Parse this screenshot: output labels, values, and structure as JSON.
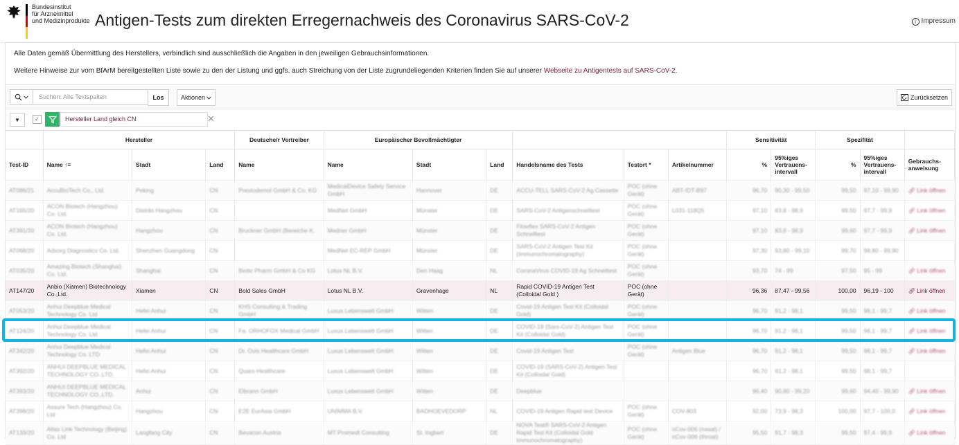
{
  "header": {
    "logo_text": "Bundesinstitut\nfür Arzneimittel\nund Medizinprodukte",
    "title": "Antigen-Tests zum direkten Erregernachweis des Coronavirus SARS-CoV-2",
    "impressum": "Impressum"
  },
  "info": {
    "line1": "Alle Daten gemäß Übermittlung des Herstellers, verbindlich sind ausschließlich die Angaben in den jeweiligen Gebrauchsinformationen.",
    "line2_prefix": "Weitere Hinweise zur vom BfArM bereitgestellten Liste sowie zu den der Listung und ggfs. auch Streichung von der Liste zugrundeliegenden Kriterien finden Sie auf unserer ",
    "line2_link": "Webseite zu Antigentests auf SARS-CoV-2",
    "line2_suffix": "."
  },
  "toolbar": {
    "search_placeholder": "Suchen: Alle Textspalten",
    "search_value": "",
    "los": "Los",
    "aktionen": "Aktionen",
    "reset": "Zurücksetzen"
  },
  "filter": {
    "text": "Hersteller Land gleich CN"
  },
  "groups": {
    "hersteller": "Hersteller",
    "vertreiber": "Deutsche/r Vertreiber",
    "bevollmaechtigter": "Europäischer Bevollmächtigter",
    "sensitivitaet": "Sensitivität",
    "spezifitaet": "Spezifität"
  },
  "columns": {
    "test_id": "Test-ID",
    "name": "Name",
    "stadt": "Stadt",
    "land": "Land",
    "vertreiber_name": "Name",
    "ev_name": "Name",
    "ev_stadt": "Stadt",
    "ev_land": "Land",
    "handelsname": "Handelsname des Tests",
    "testort": "Testort *",
    "artikelnummer": "Artikelnummer",
    "sens_pct": "%",
    "sens_ci": "95%iges Vertrauens-intervall",
    "spez_pct": "%",
    "spez_ci": "95%iges Vertrauens-intervall",
    "gebrauchs": "Gebrauchs-anweisung"
  },
  "rows": [
    {
      "id": "AT086/21",
      "name": "AccuBioTech Co., Ltd.",
      "stadt": "Peking",
      "land": "CN",
      "vertreiber": "Prestodemol GmbH & Co. KG",
      "ev_name": "MedicalDevice Safety Service GmbH",
      "ev_stadt": "Hannover",
      "ev_land": "DE",
      "handel": "ACCU-TELL SARS-CoV-2 Ag Cassette",
      "testort": "POC (ohne Gerät)",
      "artikel": "ABT-IDT-B97",
      "sens": "96,70",
      "sens_ci": "90,30 - 99,50",
      "spez": "99,50",
      "spez_ci": "97,10 - 99,90",
      "link": "Link öffnen"
    },
    {
      "id": "AT165/20",
      "name": "ACON Biotech (Hangzhou) Co. Ltd.",
      "stadt": "Distrikt Hangzhou",
      "land": "CN",
      "vertreiber": "",
      "ev_name": "MedNet GmbH",
      "ev_stadt": "Münster",
      "ev_land": "DE",
      "handel": "SARS-CoV-2 Antigenschnelltest",
      "testort": "POC (ohne Gerät)",
      "artikel": "L031-118Q5",
      "sens": "97,10",
      "sens_ci": "83,8 - 98,9",
      "spez": "99,50",
      "spez_ci": "97,7 - 99,9",
      "link": "Link öffnen"
    },
    {
      "id": "AT391/20",
      "name": "ACON Biotech (Hangzhou) Co. Ltd.",
      "stadt": "Hangzhou",
      "land": "CN",
      "vertreiber": "Bruckner GmbH (Bereiche K.",
      "ev_name": "Medner GmbH",
      "ev_stadt": "Münster",
      "ev_land": "DE",
      "handel": "Flowflex SARS-CoV-2 Antigen Schnelltest",
      "testort": "POC (ohne Gerät)",
      "artikel": "",
      "sens": "97,10",
      "sens_ci": "83,8 - 98,9",
      "spez": "99,60",
      "spez_ci": "97,7 - 99,9",
      "link": "Link öffnen"
    },
    {
      "id": "AT068/20",
      "name": "Adsorg Diagnostics Co. Ltd.",
      "stadt": "Shenzhen Guangdong",
      "land": "CN",
      "vertreiber": "",
      "ev_name": "MedNet EC-REP GmbH",
      "ev_stadt": "Münster",
      "ev_land": "DE",
      "handel": "SARS-CoV-2 Antigen Test Kit (Immunochromatography)",
      "testort": "POC (ohne Gerät)",
      "artikel": "",
      "sens": "97,30",
      "sens_ci": "93,80 - 99,10",
      "spez": "99,70",
      "spez_ci": "98,80 - 99,90",
      "link": ""
    },
    {
      "id": "AT035/20",
      "name": "Amazing Biotech (Shanghai) Co. Ltd.",
      "stadt": "Shanghai",
      "land": "CN",
      "vertreiber": "Biotic Pharm GmbH & Co KG",
      "ev_name": "Lotus NL B.V.",
      "ev_stadt": "Den Haag",
      "ev_land": "NL",
      "handel": "CoronaVirus COVID-19 Ag Schnelltest",
      "testort": "POC (ohne Gerät)",
      "artikel": "",
      "sens": "93,70",
      "sens_ci": "74 - 99",
      "spez": "97,50",
      "spez_ci": "95 - 99",
      "link": "Link öffnen"
    },
    {
      "id": "AT147/20",
      "name": "Anbio (Xiamen) Biotechnology Co.,Ltd.",
      "stadt": "Xiamen",
      "land": "CN",
      "vertreiber": "Bold Sales GmbH",
      "ev_name": "Lotus NL B.V.",
      "ev_stadt": "Gravenhage",
      "ev_land": "NL",
      "handel": "Rapid COVID-19 Antigen Test (Colloidal Gold )",
      "testort": "POC (ohne Gerät)",
      "artikel": "",
      "sens": "96,36",
      "sens_ci": "87,47 - 99,56",
      "spez": "100,00",
      "spez_ci": "96,19 - 100",
      "link": "Link öffnen",
      "highlight": true
    },
    {
      "id": "AT053/20",
      "name": "Anhui Deepblue Medical Technology Co. Ltd",
      "stadt": "Hefei Anhui",
      "land": "CN",
      "vertreiber": "KHS Consulting & Trading GmbH",
      "ev_name": "Luxus Lebenswelt GmbH",
      "ev_stadt": "Witten",
      "ev_land": "DE",
      "handel": "Covid-19 Antigen Test Kit (Colloidal Gold)",
      "testort": "POC (ohne Gerät)",
      "artikel": "",
      "sens": "96,70",
      "sens_ci": "91,2 - 98,1",
      "spez": "99,50",
      "spez_ci": "98,1 - 99,7",
      "link": "Link öffnen"
    },
    {
      "id": "AT124/20",
      "name": "Anhui Deepblue Medical Technology Co. Ltd",
      "stadt": "Hefei Anhui",
      "land": "CN",
      "vertreiber": "Fa. ORHOFOX Medical GmbH",
      "ev_name": "Luxus Lebenswelt GmbH",
      "ev_stadt": "Witten",
      "ev_land": "DE",
      "handel": "COVID-19 (Sars-CoV-2) Antigen Test Kit (Colloidal Gold)",
      "testort": "POC (ohne Gerät)",
      "artikel": "",
      "sens": "96,70",
      "sens_ci": "91,2 - 98,1",
      "spez": "99,50",
      "spez_ci": "98,1 - 99,7",
      "link": "Link öffnen"
    },
    {
      "id": "AT342/20",
      "name": "Anhui Deepblue Medical Technology Co. LTD",
      "stadt": "Hefei Anhui",
      "land": "CN",
      "vertreiber": "Dr. Ovis Healthcare GmbH",
      "ev_name": "Luxus Lebenswelt GmbH",
      "ev_stadt": "Witten",
      "ev_land": "DE",
      "handel": "Covid-19 Antigen Test",
      "testort": "POC (ohne Gerät)",
      "artikel": "Antigen Blue",
      "sens": "96,70",
      "sens_ci": "91,2 - 98,1",
      "spez": "99,50",
      "spez_ci": "98,1 - 99,7",
      "link": "Link öffnen"
    },
    {
      "id": "AT392/20",
      "name": "ANHUI DEEPBLUE MEDICAL TECHNOLOGY CO.,LTD.",
      "stadt": "Hefei Anhui",
      "land": "CN",
      "vertreiber": "Quaro Healthcare",
      "ev_name": "Luxus Lebenswelt GmbH",
      "ev_stadt": "Witten",
      "ev_land": "DE",
      "handel": "COVID-19 (SARS-CoV-2) Antigen Test Kit (Colloidal Gold)",
      "testort": "",
      "artikel": "",
      "sens": "96,70",
      "sens_ci": "91,2 - 98,1",
      "spez": "99,50",
      "spez_ci": "98,1 - 99,7",
      "link": ""
    },
    {
      "id": "AT393/20",
      "name": "ANHUI DEEPBLUE MEDICAL TECHNOLOGY CO.,LTD.",
      "stadt": "Anhui",
      "land": "CN",
      "vertreiber": "Elbrann GmbH",
      "ev_name": "Luxus Lebenswelt GmbH",
      "ev_stadt": "Witten",
      "ev_land": "DE",
      "handel": "Deepblue",
      "testort": "",
      "artikel": "",
      "sens": "96,40",
      "sens_ci": "90,80 - 99,20",
      "spez": "99,60",
      "spez_ci": "94,40 - 99,90",
      "link": "Link öffnen"
    },
    {
      "id": "AT398/20",
      "name": "Assure Tech (Hangzhou) Co. Ltd",
      "stadt": "Hangzhou",
      "land": "CN",
      "vertreiber": "E2E EurAsia GmbH",
      "ev_name": "UNIMMA B.V.",
      "ev_stadt": "BADHOEVEDORP",
      "ev_land": "NL",
      "handel": "COVID-19 Antigen Rapid test Device",
      "testort": "POC (ohne Gerät)",
      "artikel": "COV-803",
      "sens": "92,00",
      "sens_ci": "73,9 - 98,3",
      "spez": "100,00",
      "spez_ci": "97,7 - 100,0",
      "link": "Link öffnen"
    },
    {
      "id": "AT133/20",
      "name": "Atlas Link Technology (Beijing) Co. Ltd",
      "stadt": "Langfang City",
      "land": "CN",
      "vertreiber": "Bevacon Austria",
      "ev_name": "MT Promedt Consulting",
      "ev_stadt": "St. Ingbert",
      "ev_land": "DE",
      "handel": "NOVA Test® SARS-CoV-2 Antigen Rapid Test Kit (Colloidal Gold Immunochromatography)",
      "testort": "POC (ohne Gerät)",
      "artikel": "nCov-006 (nasal) / nCov-006 (throat)",
      "sens": "95,50",
      "sens_ci": "91,7 - 98,3",
      "spez": "99,50",
      "spez_ci": "97,4 - 99,9",
      "link": "Link öffnen"
    }
  ]
}
